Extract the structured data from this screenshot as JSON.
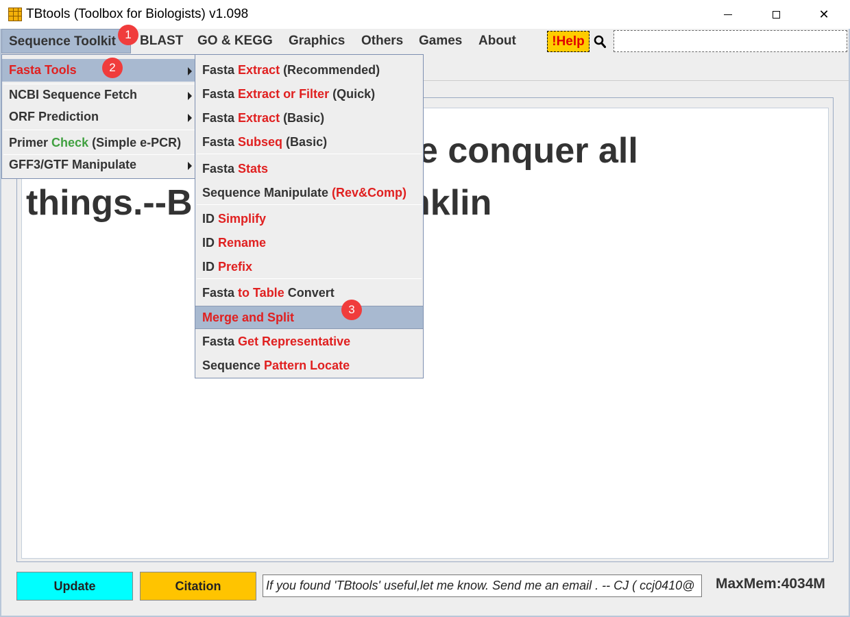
{
  "window": {
    "title": "TBtools (Toolbox for Biologists) v1.098",
    "minimize": "minimize",
    "maximize": "maximize",
    "close": "✕"
  },
  "menubar": {
    "items": [
      "Sequence Toolkit",
      "BLAST",
      "GO & KEGG",
      "Graphics",
      "Others",
      "Games",
      "About"
    ],
    "help": "!Help"
  },
  "content": {
    "quote_line1": "e conquer all",
    "quote_line2": "things.--B",
    "quote_line2_end": "nklin"
  },
  "bottom": {
    "update": "Update",
    "citation": "Citation",
    "message": "If you found 'TBtools' useful,let me know. Send me an email . -- CJ   ( ccj0410@",
    "maxmem": "MaxMem:4034M"
  },
  "sequence_menu": {
    "fasta_tools": "Fasta Tools",
    "ncbi_fetch": "NCBI Sequence Fetch",
    "orf_prediction": "ORF Prediction",
    "primer_a": "Primer ",
    "primer_b": "Check",
    "primer_c": " (Simple e-PCR)",
    "gff3": "GFF3/GTF Manipulate"
  },
  "fasta_menu": {
    "items": [
      {
        "a": "Fasta ",
        "b": "Extract",
        "c": " (Recommended)"
      },
      {
        "a": "Fasta ",
        "b": "Extract or Filter",
        "c": " (Quick)"
      },
      {
        "a": "Fasta ",
        "b": "Extract",
        "c": " (Basic)"
      },
      {
        "a": "Fasta ",
        "b": "Subseq",
        "c": " (Basic)"
      },
      {
        "a": "Fasta ",
        "b": "Stats",
        "c": ""
      },
      {
        "a": "Sequence Manipulate ",
        "b": "(Rev&Comp)",
        "c": ""
      },
      {
        "a": "ID ",
        "b": "Simplify",
        "c": ""
      },
      {
        "a": "ID ",
        "b": "Rename",
        "c": ""
      },
      {
        "a": "ID ",
        "b": "Prefix",
        "c": ""
      },
      {
        "a": "Fasta ",
        "b": "to Table",
        "c": " Convert"
      },
      {
        "a": "",
        "b": "Merge and Split",
        "c": ""
      },
      {
        "a": "Fasta ",
        "b": "Get Representative",
        "c": ""
      },
      {
        "a": "Sequence ",
        "b": "Pattern Locate",
        "c": ""
      }
    ]
  },
  "badges": [
    "1",
    "2",
    "3"
  ],
  "colors": {
    "accent_red": "#e02020",
    "selection": "#a8b9d0",
    "update_btn": "#00ffff",
    "citation_btn": "#ffc400",
    "help_btn": "#ffcc00",
    "badge": "#f03c3c"
  }
}
